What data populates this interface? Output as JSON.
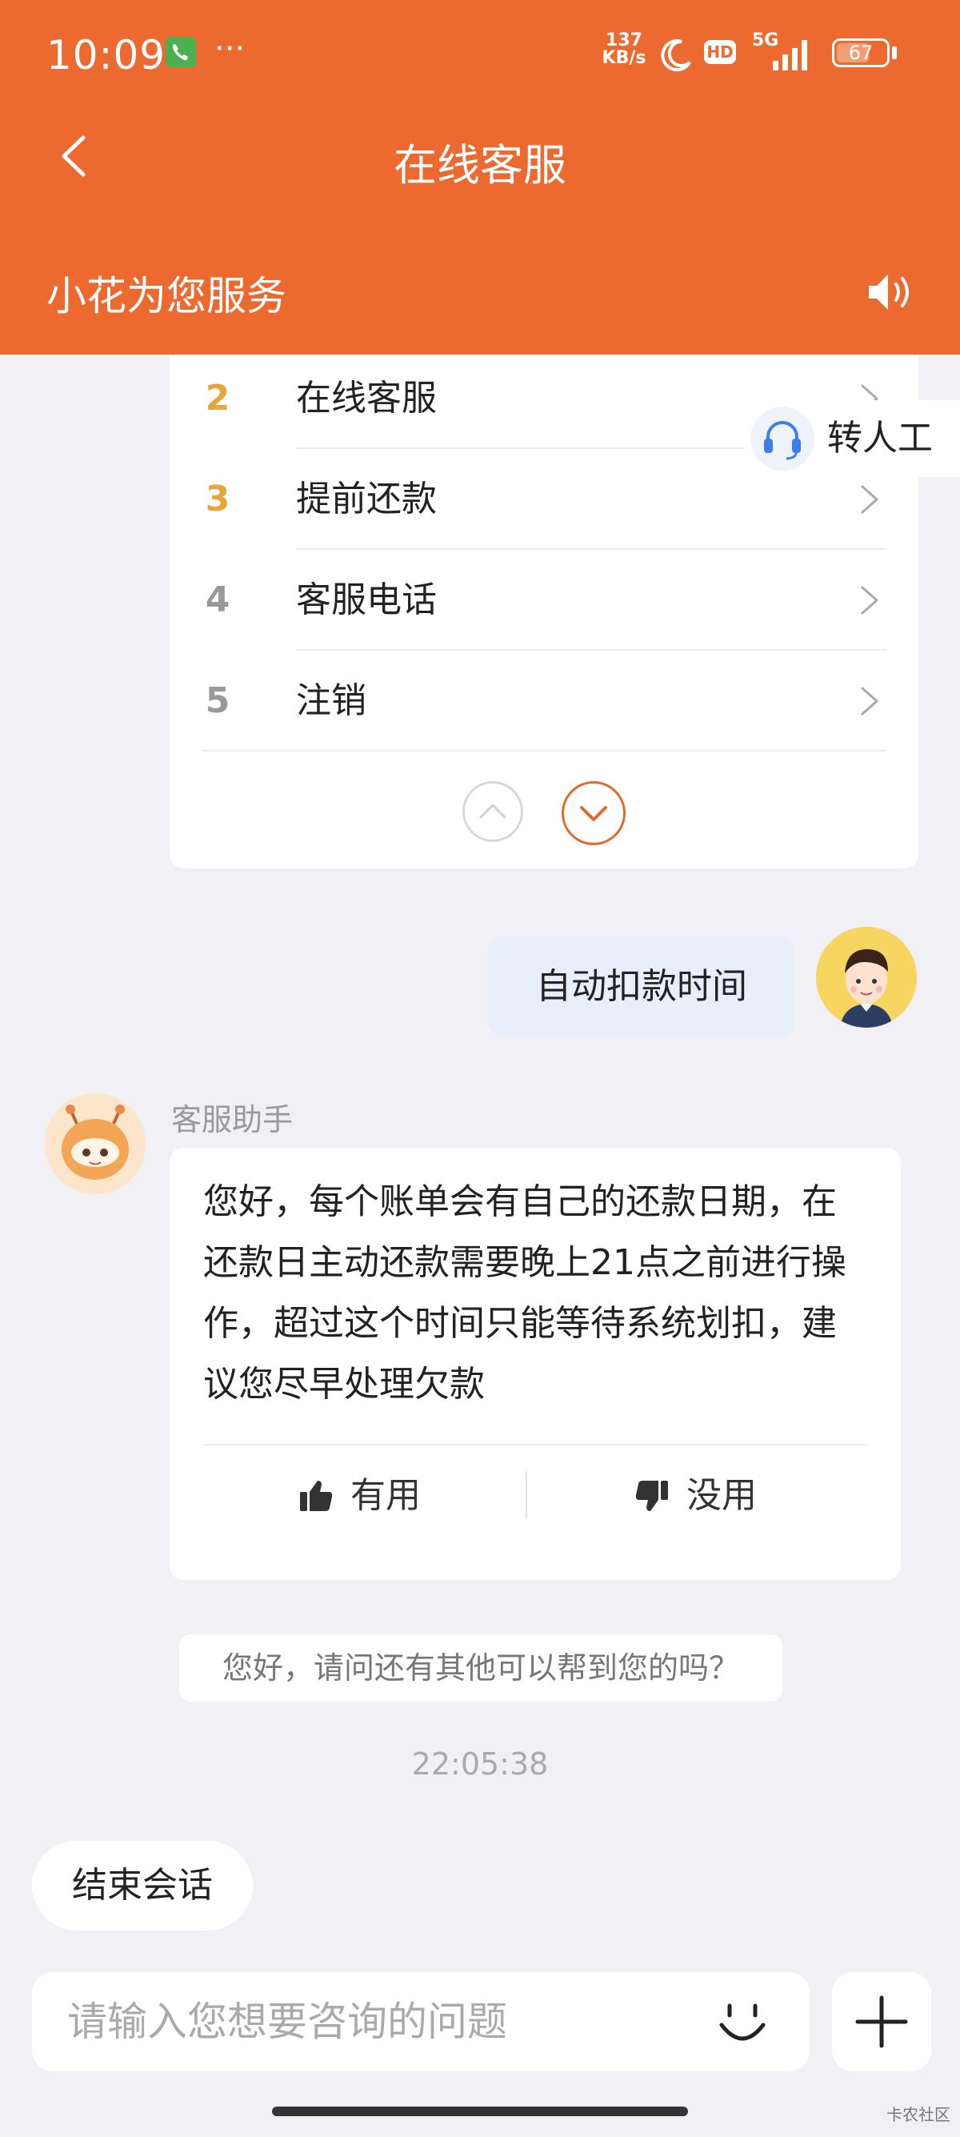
{
  "status_bar": {
    "time": "10:09",
    "net_speed_value": "137",
    "net_speed_unit": "KB/s",
    "network": "5G",
    "hd": "HD",
    "battery": "67",
    "battery_level": 0.67
  },
  "nav": {
    "title": "在线客服"
  },
  "service_banner": {
    "title": "小花为您服务"
  },
  "menu": {
    "items": [
      {
        "num": "2",
        "label": "在线客服"
      },
      {
        "num": "3",
        "label": "提前还款"
      },
      {
        "num": "4",
        "label": "客服电话"
      },
      {
        "num": "5",
        "label": "注销"
      }
    ]
  },
  "transfer": {
    "label": "转人工"
  },
  "user_message": {
    "text": "自动扣款时间"
  },
  "bot": {
    "name": "客服助手",
    "message": "您好，每个账单会有自己的还款日期，在还款日主动还款需要晚上21点之前进行操作，超过这个时间只能等待系统划扣，建议您尽早处理欠款",
    "useful_label": "有用",
    "useless_label": "没用"
  },
  "followup": {
    "text": "您好，请问还有其他可以帮到您的吗？"
  },
  "timestamp": "22:05:38",
  "end_session": {
    "label": "结束会话"
  },
  "input": {
    "placeholder": "请输入您想要咨询的问题"
  },
  "watermark": "卡农社区",
  "colors": {
    "brand": "#ec6a2f",
    "num_highlight": "#e9a43a",
    "num_normal": "#999999",
    "background": "#f0f0f5"
  }
}
